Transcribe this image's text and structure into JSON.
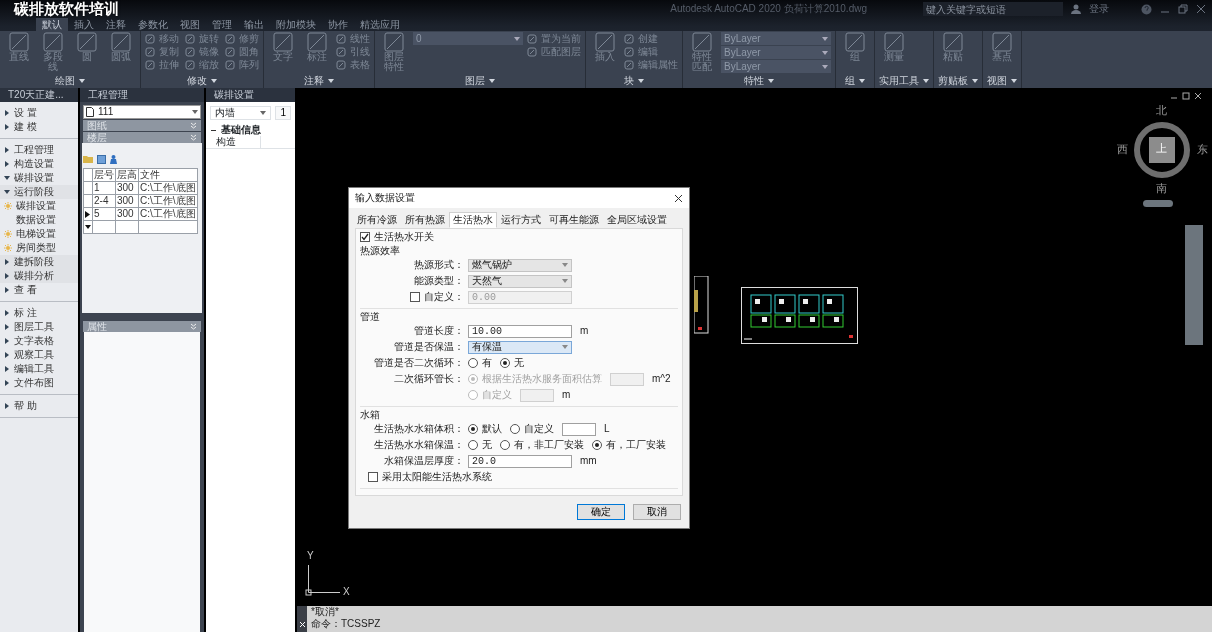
{
  "caption": "碳排放软件培训",
  "window": {
    "title": "Autodesk AutoCAD 2020   负荷计算2010.dwg",
    "search_placeholder": "键入关键字或短语",
    "sign_in": "登录"
  },
  "ribbon_tabs": [
    {
      "label": "默认",
      "selected": true
    },
    {
      "label": "插入",
      "selected": false
    },
    {
      "label": "注释",
      "selected": false
    },
    {
      "label": "参数化",
      "selected": false
    },
    {
      "label": "视图",
      "selected": false
    },
    {
      "label": "管理",
      "selected": false
    },
    {
      "label": "输出",
      "selected": false
    },
    {
      "label": "附加模块",
      "selected": false
    },
    {
      "label": "协作",
      "selected": false
    },
    {
      "label": "精选应用",
      "selected": false
    }
  ],
  "ribbon_panels": [
    {
      "title": "绘图",
      "tools": [
        {
          "label": "直线",
          "kind": "large"
        },
        {
          "label": "多段线",
          "kind": "large"
        },
        {
          "label": "圆",
          "kind": "large"
        },
        {
          "label": "圆弧",
          "kind": "large"
        }
      ]
    },
    {
      "title": "修改",
      "tools": [
        {
          "label": "移动",
          "kind": "small"
        },
        {
          "label": "复制",
          "kind": "small"
        },
        {
          "label": "拉伸",
          "kind": "small"
        },
        {
          "label": "旋转",
          "kind": "small"
        },
        {
          "label": "镜像",
          "kind": "small"
        },
        {
          "label": "缩放",
          "kind": "small"
        },
        {
          "label": "修剪",
          "kind": "small"
        },
        {
          "label": "圆角",
          "kind": "small"
        },
        {
          "label": "阵列",
          "kind": "small"
        }
      ]
    },
    {
      "title": "注释",
      "tools": [
        {
          "label": "文字",
          "kind": "large"
        },
        {
          "label": "标注",
          "kind": "large"
        },
        {
          "label": "线性",
          "kind": "small"
        },
        {
          "label": "引线",
          "kind": "small"
        },
        {
          "label": "表格",
          "kind": "small"
        }
      ]
    },
    {
      "title": "图层",
      "tools": [
        {
          "label": "图层特性",
          "kind": "large"
        },
        {
          "label": "置为当前",
          "kind": "small"
        },
        {
          "label": "匹配图层",
          "kind": "small"
        }
      ],
      "dropdowns": [
        "0"
      ]
    },
    {
      "title": "块",
      "tools": [
        {
          "label": "插入",
          "kind": "large"
        },
        {
          "label": "创建",
          "kind": "small"
        },
        {
          "label": "编辑",
          "kind": "small"
        },
        {
          "label": "编辑属性",
          "kind": "small"
        }
      ]
    },
    {
      "title": "特性",
      "tools": [
        {
          "label": "特性匹配",
          "kind": "large"
        }
      ],
      "dropdowns": [
        "ByLayer",
        "ByLayer",
        "ByLayer"
      ]
    },
    {
      "title": "组",
      "tools": [
        {
          "label": "组",
          "kind": "large"
        }
      ]
    },
    {
      "title": "实用工具",
      "tools": [
        {
          "label": "测量",
          "kind": "large"
        }
      ]
    },
    {
      "title": "剪贴板",
      "tools": [
        {
          "label": "粘贴",
          "kind": "large"
        }
      ]
    },
    {
      "title": "视图",
      "tools": [
        {
          "label": "基点",
          "kind": "large"
        }
      ]
    }
  ],
  "t20_panel": {
    "title": "T20天正建...",
    "groups": [
      [
        {
          "label": "设 置",
          "expanded": false
        },
        {
          "label": "建 模",
          "expanded": false
        }
      ],
      [
        {
          "label": "工程管理",
          "expanded": false
        },
        {
          "label": "构造设置",
          "expanded": false
        },
        {
          "label": "碳排设置",
          "expanded": true,
          "children": [
            {
              "label": "运行阶段",
              "expanded": true,
              "children": [
                {
                  "label": "碳排设置",
                  "kind": "sun"
                },
                {
                  "label": "数据设置",
                  "kind": "plain"
                },
                {
                  "label": "电梯设置",
                  "kind": "sun"
                },
                {
                  "label": "房间类型",
                  "kind": "sun"
                }
              ]
            },
            {
              "label": "建拆阶段",
              "expanded": false
            },
            {
              "label": "碳排分析",
              "expanded": false
            }
          ]
        },
        {
          "label": "查 看",
          "expanded": false
        }
      ],
      [
        {
          "label": "标 注",
          "expanded": false
        },
        {
          "label": "图层工具",
          "expanded": false
        },
        {
          "label": "文字表格",
          "expanded": false
        },
        {
          "label": "观察工具",
          "expanded": false
        },
        {
          "label": "编辑工具",
          "expanded": false
        },
        {
          "label": "文件布图",
          "expanded": false
        }
      ],
      [
        {
          "label": "帮 助",
          "expanded": false
        }
      ]
    ]
  },
  "project_panel": {
    "title": "工程管理",
    "project": "111",
    "sections": [
      "图纸",
      "楼层"
    ],
    "table": {
      "columns": [
        "层号",
        "层高",
        "文件"
      ],
      "rows": [
        {
          "cells": [
            "1",
            "300",
            "C:\\工作\\底图"
          ],
          "current": false
        },
        {
          "cells": [
            "2-4",
            "300",
            "C:\\工作\\底图"
          ],
          "current": false
        },
        {
          "cells": [
            "5",
            "300",
            "C:\\工作\\底图"
          ],
          "current": true
        }
      ],
      "new_row": true
    },
    "properties_title": "属性"
  },
  "carbon_panel": {
    "title": "碳排设置",
    "selector": "内墙",
    "page_button": "1",
    "categories": [
      {
        "title": "基础信息",
        "expanded": true,
        "properties": [
          "构造"
        ]
      }
    ]
  },
  "dialog": {
    "title": "输入数据设置",
    "tabs": [
      {
        "label": "所有冷源",
        "selected": false
      },
      {
        "label": "所有热源",
        "selected": false
      },
      {
        "label": "生活热水",
        "selected": true
      },
      {
        "label": "运行方式",
        "selected": false
      },
      {
        "label": "可再生能源",
        "selected": false
      },
      {
        "label": "全局区域设置",
        "selected": false
      }
    ],
    "switch": {
      "label": "生活热水开关",
      "checked": true
    },
    "groups": [
      {
        "title": "热源效率",
        "rows": [
          {
            "kind": "select",
            "label": "热源形式：",
            "value": "燃气锅炉",
            "focused": false
          },
          {
            "kind": "select",
            "label": "能源类型：",
            "value": "天然气",
            "focused": false
          },
          {
            "kind": "check-input",
            "label": "自定义：",
            "checked": false,
            "value": "0.00"
          }
        ]
      },
      {
        "title": "管道",
        "rows": [
          {
            "kind": "input",
            "label": "管道长度：",
            "value": "10.00",
            "unit": "m"
          },
          {
            "kind": "select",
            "label": "管道是否保温：",
            "value": "有保温",
            "focused": true
          },
          {
            "kind": "radios",
            "label": "管道是否二次循环：",
            "disabled": false,
            "options": [
              {
                "label": "有",
                "selected": false
              },
              {
                "label": "无",
                "selected": true
              }
            ]
          },
          {
            "kind": "radios",
            "label": "二次循环管长：",
            "disabled": true,
            "options": [
              {
                "label": "根据生活热水服务面积估算",
                "selected": true
              }
            ],
            "unit": "m^2"
          },
          {
            "kind": "radios",
            "disabled": true,
            "options": [
              {
                "label": "自定义",
                "selected": false
              }
            ],
            "unit": "m"
          }
        ]
      },
      {
        "title": "水箱",
        "rows": [
          {
            "kind": "radios",
            "label": "生活热水水箱体积：",
            "disabled": false,
            "options": [
              {
                "label": "默认",
                "selected": true
              },
              {
                "label": "自定义",
                "selected": false
              }
            ],
            "unit": "L"
          },
          {
            "kind": "radios",
            "label": "生活热水水箱保温：",
            "disabled": false,
            "options": [
              {
                "label": "无",
                "selected": false
              },
              {
                "label": "有，非工厂安装",
                "selected": false
              },
              {
                "label": "有，工厂安装",
                "selected": true
              }
            ]
          },
          {
            "kind": "input",
            "label": "水箱保温层厚度：",
            "value": "20.0",
            "unit": "mm"
          },
          {
            "kind": "check",
            "label": "采用太阳能生活热水系统",
            "checked": false
          }
        ]
      }
    ],
    "buttons": [
      {
        "label": "确定",
        "default": true
      },
      {
        "label": "取消",
        "default": false
      }
    ]
  },
  "compass": {
    "north": "北",
    "south": "南",
    "west": "西",
    "east": "东",
    "center": "上"
  },
  "ucs": {
    "x": "X",
    "y": "Y"
  },
  "command_lines": [
    "*取消*",
    "命令：TCSSPZ"
  ]
}
